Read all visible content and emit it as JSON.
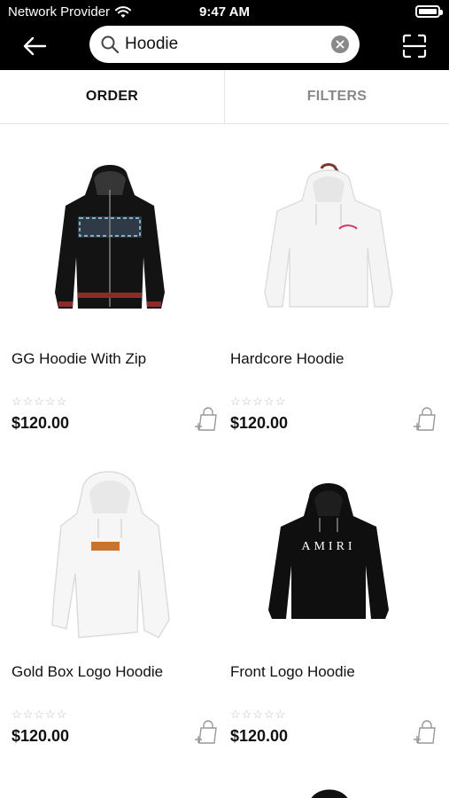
{
  "status_bar": {
    "carrier": "Network Provider",
    "time": "9:47 AM"
  },
  "header": {
    "search": {
      "value": "Hoodie",
      "placeholder": ""
    }
  },
  "tabs": [
    {
      "label": "ORDER"
    },
    {
      "label": "FILTERS"
    }
  ],
  "products": [
    {
      "name": "GG Hoodie With Zip",
      "price": "$120.00",
      "rating": 0,
      "max_rating": 5,
      "image": "black-zip-hoodie-icon"
    },
    {
      "name": "Hardcore Hoodie",
      "price": "$120.00",
      "rating": 0,
      "max_rating": 5,
      "image": "white-hoodie-icon"
    },
    {
      "name": "Gold Box Logo Hoodie",
      "price": "$120.00",
      "rating": 0,
      "max_rating": 5,
      "image": "white-boxlogo-hoodie-icon"
    },
    {
      "name": "Front Logo Hoodie",
      "price": "$120.00",
      "rating": 0,
      "max_rating": 5,
      "image": "black-logo-hoodie-icon",
      "logo_text": "AMIRI"
    }
  ],
  "colors": {
    "header_bg": "#000000",
    "tab_active": "#111111",
    "tab_inactive": "#888888",
    "star_empty": "#bdbdbd"
  }
}
